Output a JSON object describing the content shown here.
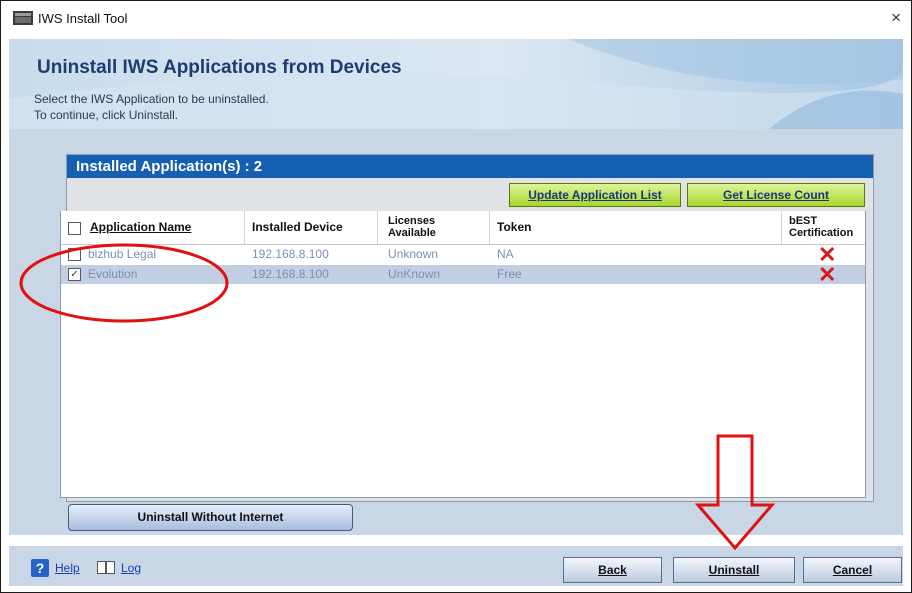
{
  "window": {
    "title": "IWS Install Tool",
    "close_glyph": "×"
  },
  "header": {
    "title": "Uninstall IWS Applications from Devices",
    "subtitle_line1": "Select the IWS Application to be  uninstalled.",
    "subtitle_line2": "To continue, click Uninstall."
  },
  "panel": {
    "heading": "Installed Application(s) : 2",
    "update_button": "Update Application List",
    "license_button": "Get License Count"
  },
  "table": {
    "columns": {
      "app_name": "Application Name",
      "device": "Installed Device",
      "licenses_line1": "Licenses",
      "licenses_line2": "Available",
      "token": "Token",
      "best_line1": "bEST",
      "best_line2": "Certification"
    },
    "rows": [
      {
        "checked": false,
        "name": "bizhub Legal",
        "device": "192.168.8.100",
        "licenses": "Unknown",
        "token": "NA",
        "best": "✕"
      },
      {
        "checked": true,
        "name": "Evolution",
        "device": "192.168.8.100",
        "licenses": "UnKnown",
        "token": "Free",
        "best": "✕"
      }
    ]
  },
  "uninstall_without_internet": "Uninstall Without Internet",
  "footer": {
    "help_icon": "?",
    "help": "Help",
    "log": "Log",
    "back": "Back",
    "uninstall": "Uninstall",
    "cancel": "Cancel"
  },
  "icons": {
    "title_icon": "window-app-icon",
    "help_icon": "question-icon",
    "log_icon": "book-icon",
    "best_status": "red-x-icon"
  },
  "colors": {
    "panel_header": "#1560b0",
    "green_button": "#a9d42c",
    "selected_row": "#c2cfe3",
    "annotation_red": "#e11111"
  }
}
